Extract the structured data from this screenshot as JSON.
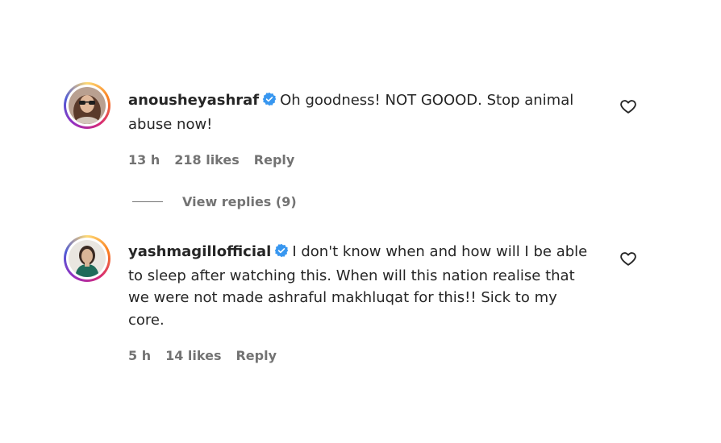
{
  "comments": [
    {
      "username": "anousheyashraf",
      "text": "Oh goodness! NOT GOOOD. Stop animal abuse now!",
      "time": "13 h",
      "likes": "218 likes",
      "reply_label": "Reply",
      "view_replies": "View replies (9)"
    },
    {
      "username": "yashmagillofficial",
      "text": "I don't know when and how will I be able to sleep after watching this. When will this nation realise that we were not made ashraful makhluqat for this!! Sick to my core.",
      "time": "5 h",
      "likes": "14 likes",
      "reply_label": "Reply"
    }
  ],
  "colors": {
    "verified": "#3897f0",
    "text": "#262626",
    "meta": "#737373"
  },
  "icons": {
    "verified": "verified-badge-icon",
    "like": "heart-outline-icon"
  }
}
